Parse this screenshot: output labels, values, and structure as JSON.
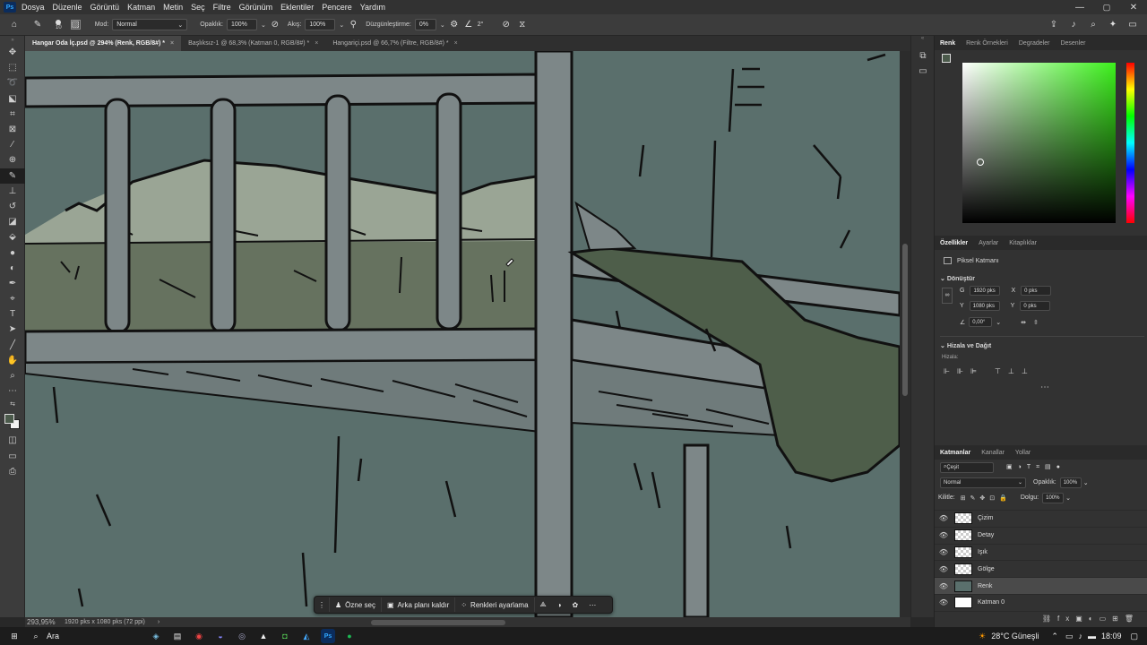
{
  "menu": {
    "items": [
      "Dosya",
      "Düzenle",
      "Görüntü",
      "Katman",
      "Metin",
      "Seç",
      "Filtre",
      "Görünüm",
      "Eklentiler",
      "Pencere",
      "Yardım"
    ]
  },
  "options": {
    "mode_label": "Mod:",
    "mode_value": "Normal",
    "opacity_label": "Opaklık:",
    "opacity_value": "100%",
    "flow_label": "Akış:",
    "flow_value": "100%",
    "smoothing_label": "Düzgünleştirme:",
    "smoothing_value": "0%",
    "angle_value": "2°",
    "brush_size": "10"
  },
  "tabs": [
    {
      "label": "Hangar Oda İç.psd @ 294% (Renk, RGB/8#) *"
    },
    {
      "label": "Başlıksız-1 @ 68,3% (Katman 0, RGB/8#) *"
    },
    {
      "label": "Hangariçi.psd @ 66,7% (Filtre, RGB/8#) *"
    }
  ],
  "color_panel": {
    "tabs": [
      "Renk",
      "Renk Örnekleri",
      "Degradeler",
      "Desenler"
    ]
  },
  "properties_panel": {
    "tabs": [
      "Özellikler",
      "Ayarlar",
      "Kitaplıklar"
    ],
    "layer_type": "Piksel Katmanı",
    "transform_title": "Dönüştür",
    "w_label": "G",
    "w_value": "1920 pks",
    "h_label": "Y",
    "h_value": "1080 pks",
    "x_label": "X",
    "x_value": "0 pks",
    "y_label": "Y",
    "y_value": "0 pks",
    "angle_value": "0,00°",
    "align_title": "Hizala ve Dağıt",
    "align_label": "Hizala:"
  },
  "layers_panel": {
    "tabs": [
      "Katmanlar",
      "Kanallar",
      "Yollar"
    ],
    "filter_label": "Çeşit",
    "blend_mode": "Normal",
    "opacity_label": "Opaklık:",
    "opacity_value": "100%",
    "lock_label": "Kilitle:",
    "fill_label": "Dolgu:",
    "fill_value": "100%",
    "layers": [
      {
        "name": "Çizim",
        "selected": false
      },
      {
        "name": "Detay",
        "selected": false
      },
      {
        "name": "Işık",
        "selected": false
      },
      {
        "name": "Gölge",
        "selected": false
      },
      {
        "name": "Renk",
        "selected": true
      },
      {
        "name": "Katman 0",
        "selected": false
      }
    ]
  },
  "contextual_bar": {
    "select_subject": "Özne seç",
    "remove_bg": "Arka planı kaldır",
    "adjust_colors": "Renkleri ayarlama"
  },
  "status": {
    "zoom": "293,95%",
    "doc_info": "1920 pks x 1080 pks (72 ppi)"
  },
  "taskbar": {
    "search_label": "Ara",
    "weather": "28°C  Güneşli",
    "time": "18:09"
  },
  "colors": {
    "canvas_bg": "#5a6f6c",
    "rail": "#7d8788",
    "hill": "#9aa595",
    "ground": "#66725f",
    "blanket": "#4e5e4a",
    "accent": "#31a8ff"
  }
}
